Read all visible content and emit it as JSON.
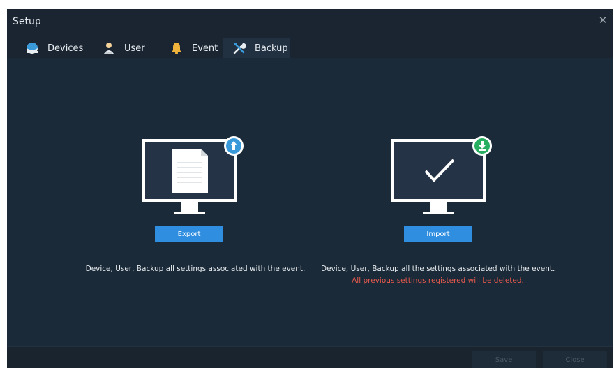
{
  "window": {
    "title": "Setup"
  },
  "tabs": [
    {
      "label": "Devices",
      "icon": "devices-icon"
    },
    {
      "label": "User",
      "icon": "user-icon"
    },
    {
      "label": "Event",
      "icon": "bell-icon"
    },
    {
      "label": "Backup",
      "icon": "tools-icon",
      "active": true
    }
  ],
  "export": {
    "button_label": "Export",
    "description": "Device, User, Backup all settings associated with the event.",
    "badge_color": "#3a9ad9"
  },
  "import": {
    "button_label": "Import",
    "description": "Device, User, Backup all the settings associated with the event.",
    "warning": "All previous settings registered will be deleted.",
    "badge_color": "#27ae60"
  },
  "footer": {
    "save_label": "Save",
    "close_label": "Close"
  },
  "colors": {
    "accent": "#2f8ee0",
    "warning": "#e95a4e",
    "background": "#1b2a38"
  }
}
